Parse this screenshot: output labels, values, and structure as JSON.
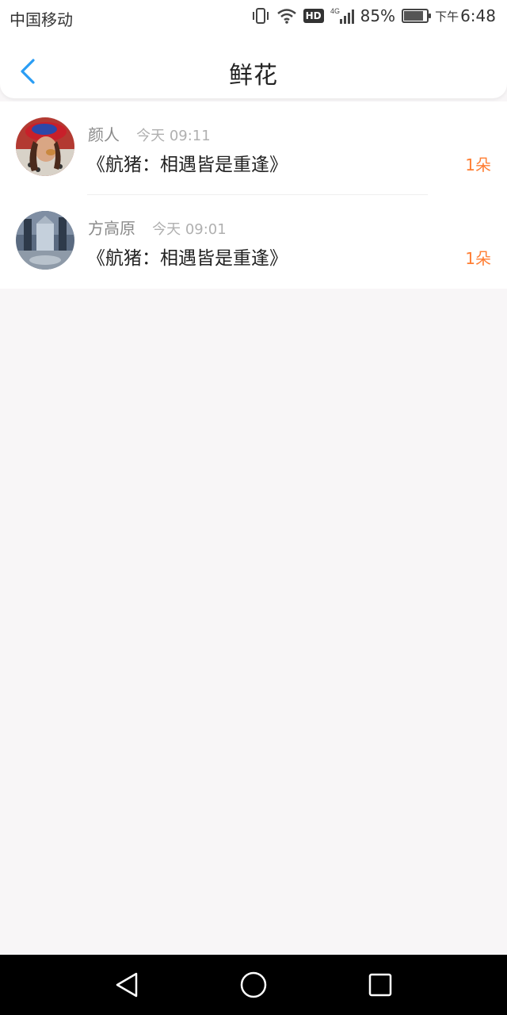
{
  "status_bar": {
    "carrier": "中国移动",
    "network": "4G",
    "hd": "HD",
    "battery_percent": "85%",
    "battery_level": 0.85,
    "time_prefix": "下午",
    "time": "6:48",
    "icons": [
      "vibrate-icon",
      "wifi-icon",
      "hd-icon",
      "signal-icon",
      "battery-icon"
    ]
  },
  "header": {
    "title": "鲜花",
    "back_icon": "chevron-left-icon",
    "accent_color": "#2a9df4"
  },
  "gifts": [
    {
      "user": "颜人",
      "time": "今天 09:11",
      "book": "《航猪：相遇皆是重逢》",
      "count": "1朵"
    },
    {
      "user": "方高原",
      "time": "今天 09:01",
      "book": "《航猪：相遇皆是重逢》",
      "count": "1朵"
    }
  ],
  "nav": {
    "icons": [
      "back-triangle-icon",
      "home-circle-icon",
      "recents-square-icon"
    ]
  },
  "colors": {
    "count": "#ff7e33",
    "background": "#f8f6f7"
  }
}
